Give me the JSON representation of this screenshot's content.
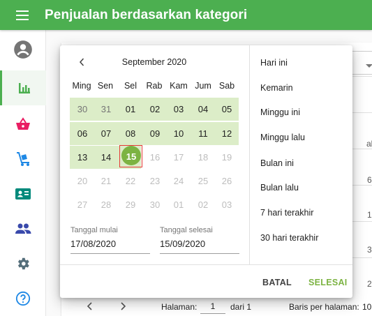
{
  "app": {
    "title": "Penjualan berdasarkan kategori"
  },
  "sidebar": {
    "items": [
      {
        "name": "account",
        "icon": "account-circle-icon"
      },
      {
        "name": "reports",
        "icon": "bar-chart-icon",
        "active": true
      },
      {
        "name": "sales",
        "icon": "basket-icon"
      },
      {
        "name": "inventory",
        "icon": "cart-dolly-icon"
      },
      {
        "name": "customers",
        "icon": "contact-card-icon"
      },
      {
        "name": "employees",
        "icon": "people-icon"
      },
      {
        "name": "settings",
        "icon": "gear-icon"
      },
      {
        "name": "help",
        "icon": "help-circle-icon"
      }
    ]
  },
  "background": {
    "row_edges": [
      "al",
      "6",
      "1",
      "3",
      "2"
    ]
  },
  "footer": {
    "page_label": "Halaman:",
    "page_value": "1",
    "page_total": "dari 1",
    "rows_per_page_label": "Baris per halaman:",
    "rows_per_page_value": "10"
  },
  "picker": {
    "month_label": "September 2020",
    "weekdays": [
      "Ming",
      "Sen",
      "Sel",
      "Rab",
      "Kam",
      "Jum",
      "Sab"
    ],
    "weeks": [
      [
        "30",
        "31",
        "01",
        "02",
        "03",
        "04",
        "05"
      ],
      [
        "06",
        "07",
        "08",
        "09",
        "10",
        "11",
        "12"
      ],
      [
        "13",
        "14",
        "15",
        "16",
        "17",
        "18",
        "19"
      ],
      [
        "20",
        "21",
        "22",
        "23",
        "24",
        "25",
        "26"
      ],
      [
        "27",
        "28",
        "29",
        "30",
        "01",
        "02",
        "03"
      ]
    ],
    "start_label": "Tanggal mulai",
    "start_value": "17/08/2020",
    "end_label": "Tanggal selesai",
    "end_value": "15/09/2020",
    "presets": [
      "Hari ini",
      "Kemarin",
      "Minggu ini",
      "Minggu lalu",
      "Bulan ini",
      "Bulan lalu",
      "7 hari terakhir",
      "30 hari terakhir"
    ],
    "cancel_label": "BATAL",
    "ok_label": "SELESAI"
  },
  "colors": {
    "primary": "#4caf50",
    "range_fill": "#dcedc8",
    "selected_day": "#7cb342",
    "focus_outline": "#e53935",
    "icon_reports": "#4caf50",
    "icon_basket": "#e91e63",
    "icon_dolly": "#1e88e5",
    "icon_card": "#00897b",
    "icon_people": "#3949ab",
    "icon_gear": "#546e7a",
    "icon_help": "#1e88e5"
  }
}
